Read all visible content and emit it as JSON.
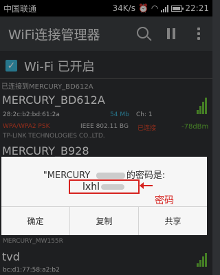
{
  "status_bar": {
    "carrier": "中国联通",
    "speed": "34K/s",
    "time": "22:21"
  },
  "app_bar": {
    "title": "WiFi连接管理器"
  },
  "wifi_toggle": {
    "label": "Wi-Fi 已开启",
    "checked": true
  },
  "sections": {
    "connected_label": "已连接到MERCURY_BD612A"
  },
  "networks": [
    {
      "ssid": "MERCURY_BD612A",
      "mac": "28:2c:b2:bd:61:2a",
      "rate": "54 Mb",
      "channel": "Ch: 1",
      "security": "WPA/WPA2 PSK",
      "standard": "IEEE 802.11 BG",
      "status": "已连接",
      "signal": "-78dBm",
      "vendor": "TP-LINK TECHNOLOGIES CO.,LTD."
    },
    {
      "ssid": "MERCURY_B928"
    },
    {
      "vendor": "MERCURY_MW155R"
    },
    {
      "ssid": "tvd",
      "mac": "bc:d1:77:58:a2:b2"
    }
  ],
  "dialog": {
    "title_prefix": "\"MERCURY_",
    "title_suffix": "的密码是:",
    "password_visible": "lxhl",
    "annotation": "密码",
    "buttons": {
      "ok": "确定",
      "copy": "复制",
      "share": "共享"
    }
  },
  "colors": {
    "accent": "#3cb5d8",
    "signal_good": "#6ac43a",
    "warn": "#e0462a",
    "annotation": "#d6221e"
  },
  "icons": [
    "search-icon",
    "pause-icon",
    "overflow-menu-icon",
    "alarm-icon",
    "wifi-icon",
    "signal-icon",
    "battery-icon",
    "checkbox-icon"
  ]
}
